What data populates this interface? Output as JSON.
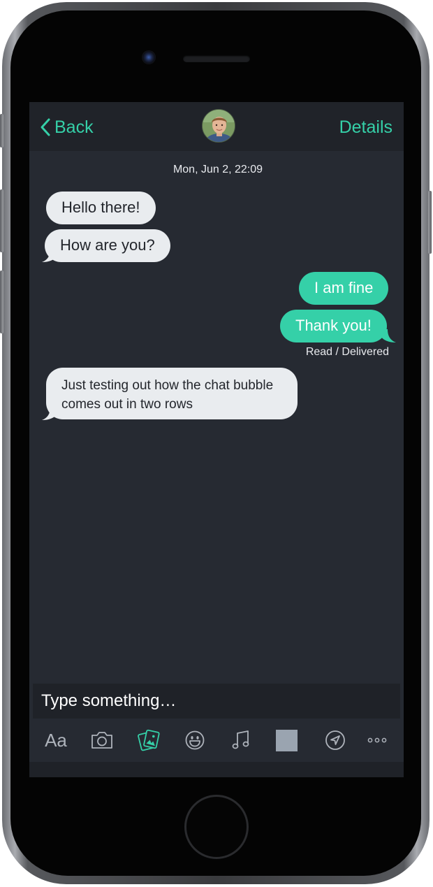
{
  "header": {
    "back_label": "Back",
    "details_label": "Details"
  },
  "conversation": {
    "timestamp": "Mon, Jun 2, 22:09",
    "messages": [
      {
        "direction": "incoming",
        "text": "Hello there!"
      },
      {
        "direction": "incoming",
        "text": "How are you?"
      },
      {
        "direction": "outgoing",
        "text": "I am fine"
      },
      {
        "direction": "outgoing",
        "text": "Thank you!"
      },
      {
        "direction": "incoming",
        "text": "Just testing out how the chat bubble comes out in two rows"
      }
    ],
    "status": "Read / Delivered"
  },
  "composer": {
    "placeholder": "Type something…",
    "font_button_label": "Aa"
  },
  "toolbar": {
    "icons": [
      "font-icon",
      "camera-icon",
      "photos-icon",
      "smiley-icon",
      "music-icon",
      "square-icon",
      "navigation-icon",
      "more-icon"
    ]
  },
  "colors": {
    "accent": "#35d0a8",
    "background": "#262a32",
    "nav_background": "#202329",
    "incoming_bubble": "#e9ecef",
    "outgoing_bubble": "#35d0a8"
  }
}
